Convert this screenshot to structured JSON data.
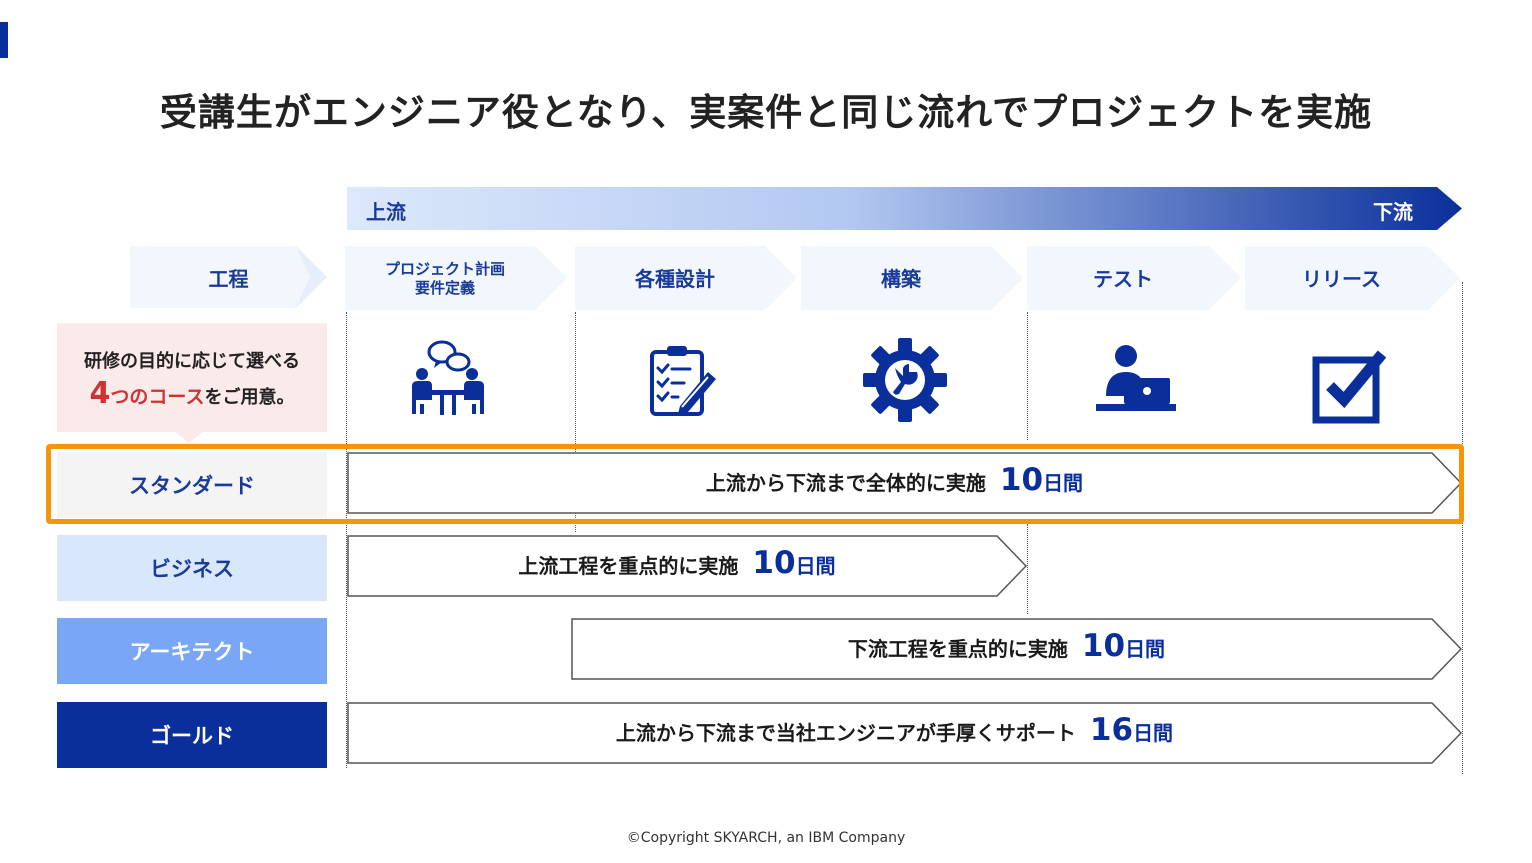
{
  "title": "受講生がエンジニア役となり、実案件と同じ流れでプロジェクトを実施",
  "flow": {
    "start": "上流",
    "end": "下流",
    "color_start": "#dce8fb",
    "color_end": "#0a2f9a"
  },
  "process_label": "工程",
  "phases": [
    {
      "lines": [
        "プロジェクト計画",
        "要件定義"
      ],
      "icon": "meeting-people-icon"
    },
    {
      "lines": [
        "各種設計"
      ],
      "icon": "clipboard-checklist-icon"
    },
    {
      "lines": [
        "構築"
      ],
      "icon": "gear-wrench-icon"
    },
    {
      "lines": [
        "テスト"
      ],
      "icon": "person-laptop-icon"
    },
    {
      "lines": [
        "リリース"
      ],
      "icon": "checkbox-icon"
    }
  ],
  "note": {
    "line1": "研修の目的に応じて選べる",
    "line2_big": "4",
    "line2_red": "つのコース",
    "line2_tail": "をご用意。"
  },
  "courses": [
    {
      "name": "スタンダード",
      "desc": "上流から下流まで全体的に実施",
      "days": "10",
      "unit": "日間",
      "bg": "#f4f4f4",
      "fg": "#1a3a9a"
    },
    {
      "name": "ビジネス",
      "desc": "上流工程を重点的に実施",
      "days": "10",
      "unit": "日間",
      "bg": "#d9e7fb",
      "fg": "#1a3a9a"
    },
    {
      "name": "アーキテクト",
      "desc": "下流工程を重点的に実施",
      "days": "10",
      "unit": "日間",
      "bg": "#7aa7f5",
      "fg": "#ffffff"
    },
    {
      "name": "ゴールド",
      "desc": "上流から下流まで当社エンジニアが手厚くサポート",
      "days": "16",
      "unit": "日間",
      "bg": "#0a2f9a",
      "fg": "#ffffff"
    }
  ],
  "highlight_color": "#f5960a",
  "copyright": "©Copyright SKYARCH, an IBM Company"
}
